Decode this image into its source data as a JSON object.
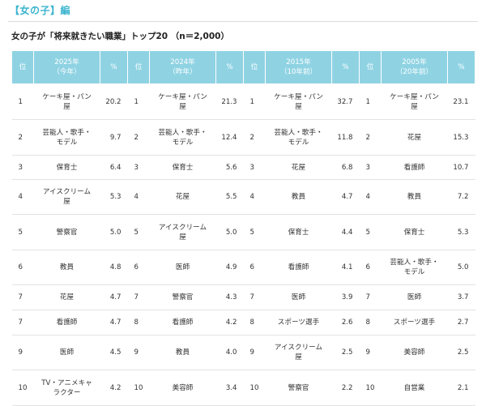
{
  "section": {
    "title": "【女の子】編"
  },
  "caption": "女の子が「将来就きたい職業」トップ20 （n＝2,000）",
  "headers": {
    "rank": "位",
    "pct": "%",
    "c2025": [
      "2025年",
      "（今年）"
    ],
    "c2024": [
      "2024年",
      "（昨年）"
    ],
    "c2015": [
      "2015年",
      "（10年前）"
    ],
    "c2005": [
      "2005年",
      "（20年前）"
    ]
  },
  "rows": [
    {
      "r25": "1",
      "j25": [
        "ケーキ屋・パン",
        "屋"
      ],
      "p25": "20.2",
      "r24": "1",
      "j24": [
        "ケーキ屋・パン",
        "屋"
      ],
      "p24": "21.3",
      "r15": "1",
      "j15": [
        "ケーキ屋・パン",
        "屋"
      ],
      "p15": "32.7",
      "r05": "1",
      "j05": [
        "ケーキ屋・パン",
        "屋"
      ],
      "p05": "23.1"
    },
    {
      "r25": "2",
      "j25": [
        "芸能人・歌手・",
        "モデル"
      ],
      "p25": "9.7",
      "r24": "2",
      "j24": [
        "芸能人・歌手・",
        "モデル"
      ],
      "p24": "12.4",
      "r15": "2",
      "j15": [
        "芸能人・歌手・",
        "モデル"
      ],
      "p15": "11.8",
      "r05": "2",
      "j05": [
        "花屋",
        ""
      ],
      "p05": "15.3"
    },
    {
      "r25": "3",
      "j25": [
        "保育士",
        ""
      ],
      "p25": "6.4",
      "r24": "3",
      "j24": [
        "保育士",
        ""
      ],
      "p24": "5.6",
      "r15": "3",
      "j15": [
        "花屋",
        ""
      ],
      "p15": "6.8",
      "r05": "3",
      "j05": [
        "看護師",
        ""
      ],
      "p05": "10.7"
    },
    {
      "r25": "4",
      "j25": [
        "アイスクリーム",
        "屋"
      ],
      "p25": "5.3",
      "r24": "4",
      "j24": [
        "花屋",
        ""
      ],
      "p24": "5.5",
      "r15": "4",
      "j15": [
        "教員",
        ""
      ],
      "p15": "4.7",
      "r05": "4",
      "j05": [
        "教員",
        ""
      ],
      "p05": "7.2"
    },
    {
      "r25": "5",
      "j25": [
        "警察官",
        ""
      ],
      "p25": "5.0",
      "r24": "5",
      "j24": [
        "アイスクリーム",
        "屋"
      ],
      "p24": "5.0",
      "r15": "5",
      "j15": [
        "保育士",
        ""
      ],
      "p15": "4.4",
      "r05": "5",
      "j05": [
        "保育士",
        ""
      ],
      "p05": "5.3"
    },
    {
      "r25": "6",
      "j25": [
        "教員",
        ""
      ],
      "p25": "4.8",
      "r24": "6",
      "j24": [
        "医師",
        ""
      ],
      "p24": "4.9",
      "r15": "6",
      "j15": [
        "看護師",
        ""
      ],
      "p15": "4.1",
      "r05": "6",
      "j05": [
        "芸能人・歌手・",
        "モデル"
      ],
      "p05": "5.0"
    },
    {
      "r25": "7",
      "j25": [
        "花屋",
        ""
      ],
      "p25": "4.7",
      "r24": "7",
      "j24": [
        "警察官",
        ""
      ],
      "p24": "4.3",
      "r15": "7",
      "j15": [
        "医師",
        ""
      ],
      "p15": "3.9",
      "r05": "7",
      "j05": [
        "医師",
        ""
      ],
      "p05": "3.7"
    },
    {
      "r25": "7",
      "j25": [
        "看護師",
        ""
      ],
      "p25": "4.7",
      "r24": "8",
      "j24": [
        "看護師",
        ""
      ],
      "p24": "4.2",
      "r15": "8",
      "j15": [
        "スポーツ選手",
        ""
      ],
      "p15": "2.6",
      "r05": "8",
      "j05": [
        "スポーツ選手",
        ""
      ],
      "p05": "2.7"
    },
    {
      "r25": "9",
      "j25": [
        "医師",
        ""
      ],
      "p25": "4.5",
      "r24": "9",
      "j24": [
        "教員",
        ""
      ],
      "p24": "4.0",
      "r15": "9",
      "j15": [
        "アイスクリーム",
        "屋"
      ],
      "p15": "2.5",
      "r05": "9",
      "j05": [
        "美容師",
        ""
      ],
      "p05": "2.5"
    },
    {
      "r25": "10",
      "j25": [
        "TV・アニメキャ",
        "ラクター"
      ],
      "p25": "4.2",
      "r24": "10",
      "j24": [
        "美容師",
        ""
      ],
      "p24": "3.4",
      "r15": "10",
      "j15": [
        "警察官",
        ""
      ],
      "p15": "2.2",
      "r05": "10",
      "j05": [
        "自営業",
        ""
      ],
      "p05": "2.1"
    }
  ],
  "colors": {
    "header_bg": "#8fd3e3",
    "accent": "#3bb4cf"
  }
}
